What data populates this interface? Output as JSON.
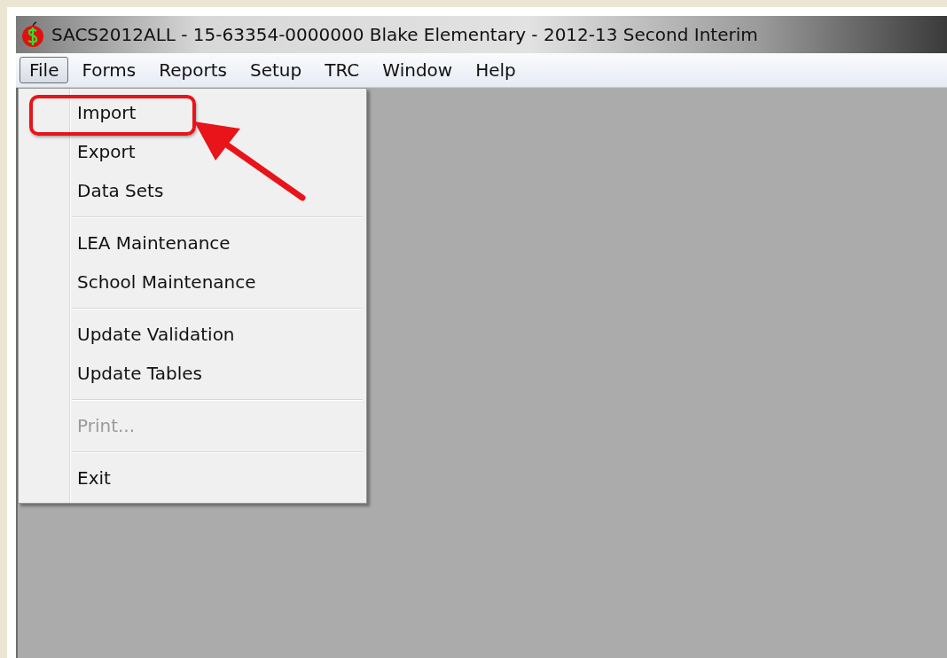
{
  "window": {
    "title": "SACS2012ALL - 15-63354-0000000  Blake Elementary - 2012-13 Second Interim"
  },
  "menu_bar": [
    {
      "label": "File",
      "selected": true
    },
    {
      "label": "Forms",
      "selected": false
    },
    {
      "label": "Reports",
      "selected": false
    },
    {
      "label": "Setup",
      "selected": false
    },
    {
      "label": "TRC",
      "selected": false
    },
    {
      "label": "Window",
      "selected": false
    },
    {
      "label": "Help",
      "selected": false
    }
  ],
  "file_menu": {
    "groups": [
      [
        {
          "label": "Import",
          "disabled": false,
          "highlighted": true
        },
        {
          "label": "Export",
          "disabled": false,
          "highlighted": false
        },
        {
          "label": "Data Sets",
          "disabled": false,
          "highlighted": false
        }
      ],
      [
        {
          "label": "LEA Maintenance",
          "disabled": false,
          "highlighted": false
        },
        {
          "label": "School Maintenance",
          "disabled": false,
          "highlighted": false
        }
      ],
      [
        {
          "label": "Update Validation",
          "disabled": false,
          "highlighted": false
        },
        {
          "label": "Update Tables",
          "disabled": false,
          "highlighted": false
        }
      ],
      [
        {
          "label": "Print...",
          "disabled": true,
          "highlighted": false
        }
      ],
      [
        {
          "label": "Exit",
          "disabled": false,
          "highlighted": false
        }
      ]
    ]
  }
}
